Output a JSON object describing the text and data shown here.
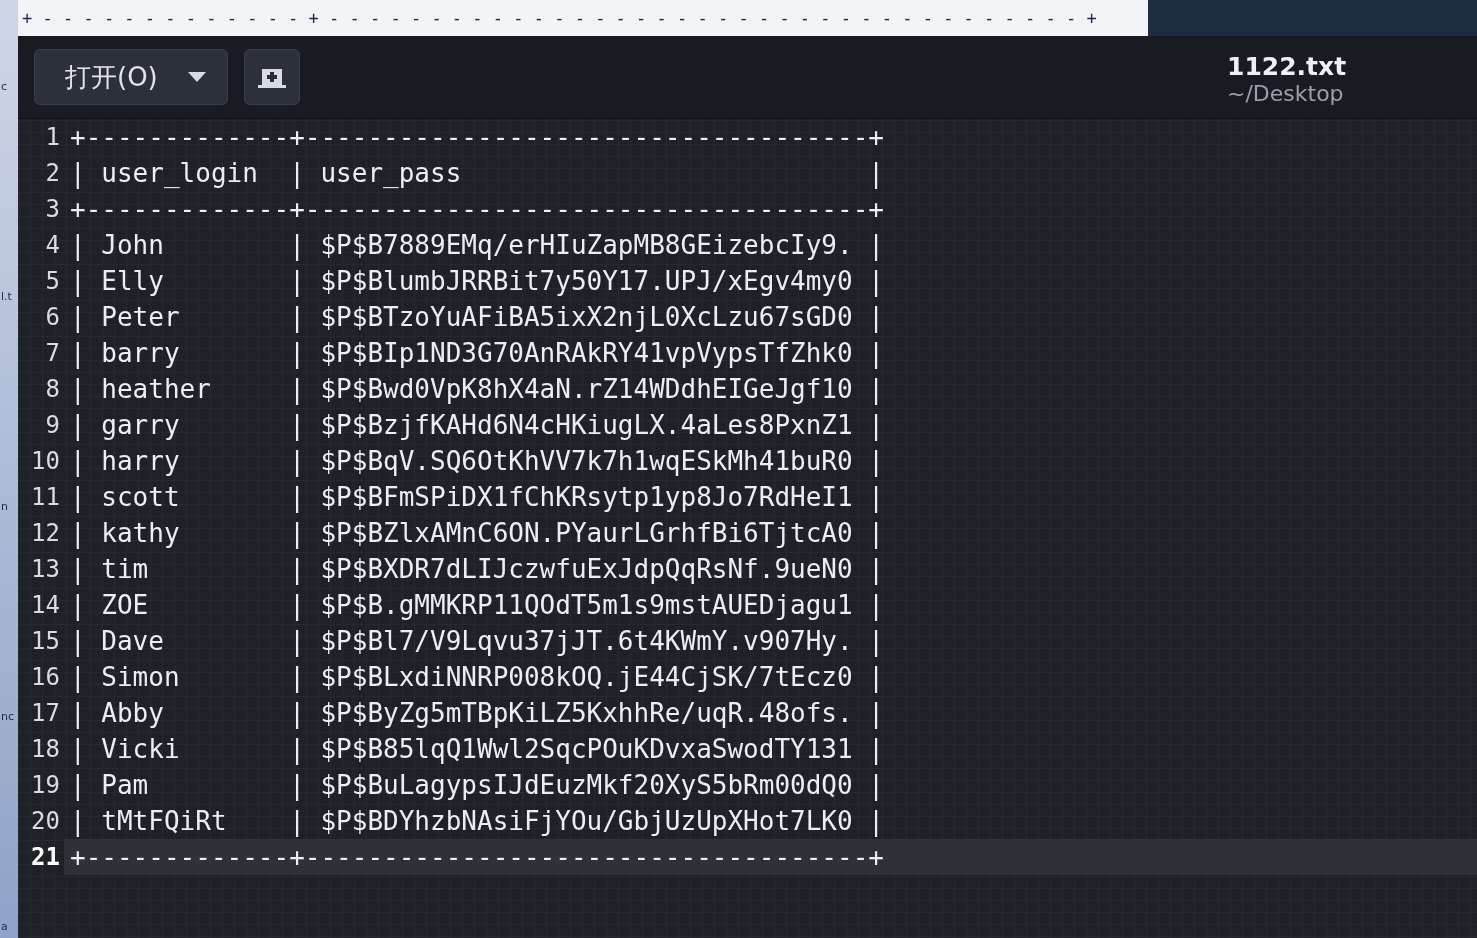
{
  "background_window": {
    "text": "+ - - - - - - - - - - - - - + - - - - - - - - - - - - - - - - - - - - - - - - - - - - - - - - - - - - - +",
    "edge_fragments": [
      "c",
      "l.t",
      "n",
      "nc",
      "a"
    ]
  },
  "toolbar": {
    "open_button": {
      "label": "打开(O)"
    },
    "file": {
      "name": "1122.txt",
      "path": "~/Desktop"
    }
  },
  "lines": [
    {
      "number": "1",
      "text": "+-------------+------------------------------------+",
      "current": false
    },
    {
      "number": "2",
      "text": "| user_login  | user_pass                          |",
      "current": false
    },
    {
      "number": "3",
      "text": "+-------------+------------------------------------+",
      "current": false
    },
    {
      "number": "4",
      "text": "| John        | $P$B7889EMq/erHIuZapMB8GEizebcIy9. |",
      "current": false
    },
    {
      "number": "5",
      "text": "| Elly        | $P$BlumbJRRBit7y50Y17.UPJ/xEgv4my0 |",
      "current": false
    },
    {
      "number": "6",
      "text": "| Peter       | $P$BTzoYuAFiBA5ixX2njL0XcLzu67sGD0 |",
      "current": false
    },
    {
      "number": "7",
      "text": "| barry       | $P$BIp1ND3G70AnRAkRY41vpVypsTfZhk0 |",
      "current": false
    },
    {
      "number": "8",
      "text": "| heather     | $P$Bwd0VpK8hX4aN.rZ14WDdhEIGeJgf10 |",
      "current": false
    },
    {
      "number": "9",
      "text": "| garry       | $P$BzjfKAHd6N4cHKiugLX.4aLes8PxnZ1 |",
      "current": false
    },
    {
      "number": "10",
      "text": "| harry       | $P$BqV.SQ6OtKhVV7k7h1wqESkMh41buR0 |",
      "current": false
    },
    {
      "number": "11",
      "text": "| scott       | $P$BFmSPiDX1fChKRsytp1yp8Jo7RdHeI1 |",
      "current": false
    },
    {
      "number": "12",
      "text": "| kathy       | $P$BZlxAMnC6ON.PYaurLGrhfBi6TjtcA0 |",
      "current": false
    },
    {
      "number": "13",
      "text": "| tim         | $P$BXDR7dLIJczwfuExJdpQqRsNf.9ueN0 |",
      "current": false
    },
    {
      "number": "14",
      "text": "| ZOE         | $P$B.gMMKRP11QOdT5m1s9mstAUEDjagu1 |",
      "current": false
    },
    {
      "number": "15",
      "text": "| Dave        | $P$Bl7/V9Lqvu37jJT.6t4KWmY.v907Hy. |",
      "current": false
    },
    {
      "number": "16",
      "text": "| Simon       | $P$BLxdiNNRP008kOQ.jE44CjSK/7tEcz0 |",
      "current": false
    },
    {
      "number": "17",
      "text": "| Abby        | $P$ByZg5mTBpKiLZ5KxhhRe/uqR.48ofs. |",
      "current": false
    },
    {
      "number": "18",
      "text": "| Vicki       | $P$B85lqQ1Wwl2SqcPOuKDvxaSwodTY131 |",
      "current": false
    },
    {
      "number": "19",
      "text": "| Pam         | $P$BuLagypsIJdEuzMkf20XyS5bRm00dQ0 |",
      "current": false
    },
    {
      "number": "20",
      "text": "| tMtFQiRt    | $P$BDYhzbNAsiFjYOu/GbjUzUpXHot7LK0 |",
      "current": false
    },
    {
      "number": "21",
      "text": "+-------------+------------------------------------+",
      "current": true
    }
  ]
}
